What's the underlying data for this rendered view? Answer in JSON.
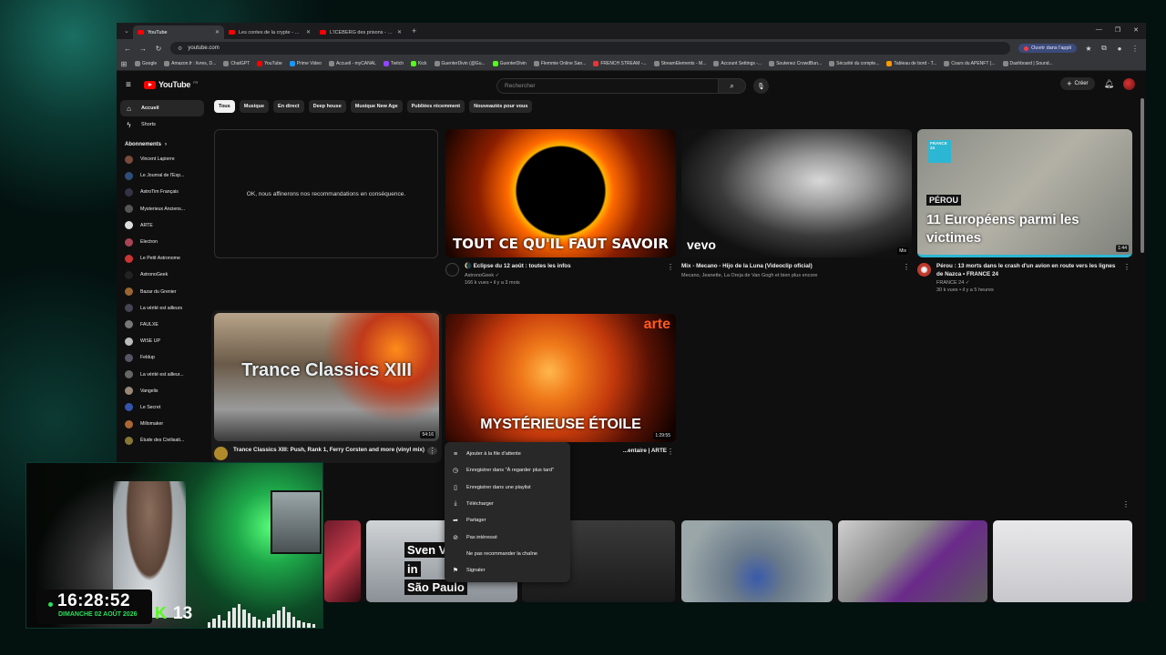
{
  "browser": {
    "tabs": [
      {
        "title": "YouTube",
        "active": true
      },
      {
        "title": "Les contes de la crypte - YouTube",
        "active": false
      },
      {
        "title": "L'ICEBERG des prisons - YouTube",
        "active": false
      }
    ],
    "url": "youtube.com",
    "open_app_label": "Ouvrir dans l'appli",
    "bookmarks": [
      "Google",
      "Amazon.fr : livres, D...",
      "ChatGPT",
      "YouTube",
      "Prime Video",
      "Accueil - myCANAL",
      "Twitch",
      "Kick",
      "GuenterDivin (@Gu...",
      "GuenterDivin",
      "Flemmie Online San...",
      "FRENCH STREAM -...",
      "StreamElements - M...",
      "Account Settings -...",
      "Soutenez CrowdBun...",
      "Sécurité du compte...",
      "Tableau de bord - T...",
      "Cours du APENFT (...",
      "Dashboard | Sound..."
    ]
  },
  "youtube": {
    "logo_text": "YouTube",
    "logo_region": "FR",
    "search_placeholder": "Rechercher",
    "create_label": "Créer",
    "sidebar": {
      "main": [
        {
          "label": "Accueil",
          "icon": "home-icon",
          "glyph": "⌂",
          "active": true
        },
        {
          "label": "Shorts",
          "icon": "shorts-icon",
          "glyph": "ϟ",
          "active": false
        }
      ],
      "subscriptions_heading": "Abonnements",
      "subscriptions": [
        {
          "label": "Vincent Lapierre",
          "color": "#7a4a3a"
        },
        {
          "label": "Le Journal de l'Esp...",
          "color": "#2e4e7a"
        },
        {
          "label": "AstroTim Français",
          "color": "#333344"
        },
        {
          "label": "Mysterieux Anciens...",
          "color": "#555555"
        },
        {
          "label": "ARTE",
          "color": "#dddddd"
        },
        {
          "label": "Electron",
          "color": "#aa4455"
        },
        {
          "label": "Le Petit Astronome",
          "color": "#cc3333"
        },
        {
          "label": "AstronoGeek",
          "color": "#222222"
        },
        {
          "label": "Bazar du Grenier",
          "color": "#996633"
        },
        {
          "label": "La vérité est ailleurs",
          "color": "#444455"
        },
        {
          "label": "FAULXE",
          "color": "#777777"
        },
        {
          "label": "WISE UP",
          "color": "#bbbbbb"
        },
        {
          "label": "Feldup",
          "color": "#555566"
        },
        {
          "label": "La vérité est ailleur...",
          "color": "#666666"
        },
        {
          "label": "Vangelis",
          "color": "#998877"
        },
        {
          "label": "Le Secret",
          "color": "#3355aa"
        },
        {
          "label": "Millomaker",
          "color": "#aa6633"
        },
        {
          "label": "Étude des Civilisati...",
          "color": "#887733"
        }
      ]
    },
    "chips": [
      {
        "label": "Tous",
        "active": true
      },
      {
        "label": "Musique",
        "active": false
      },
      {
        "label": "En direct",
        "active": false
      },
      {
        "label": "Deep house",
        "active": false
      },
      {
        "label": "Musique New Age",
        "active": false
      },
      {
        "label": "Publiées récemment",
        "active": false
      },
      {
        "label": "Nouveautés pour vous",
        "active": false
      }
    ],
    "feedback_text": "OK, nous affinerons nos recommandations en conséquence.",
    "videos": [
      {
        "title": "🌘 Eclipse du 12 août : toutes les infos",
        "channel": "AstronoGeek ✓",
        "stats": "166 k vues • il y a 3 mois",
        "thumb_text": "TOUT CE QU'IL FAUT SAVOIR",
        "duration": ""
      },
      {
        "title": "Mix - Mecano - Hijo de la Luna (Videoclip oficial)",
        "channel": "Mecano, Jeanette, La Oreja de Van Gogh et bien plus encore",
        "stats": "",
        "thumb_text": "vevo",
        "duration": "Mix"
      },
      {
        "title": "Pérou : 13 morts dans le crash d'un avion en route vers les lignes de Nazca • FRANCE 24",
        "channel": "FRANCE 24 ✓",
        "stats": "30 k vues • il y a 5 heures",
        "thumb_text": "11 Européens parmi les victimes",
        "thumb_tag": "PÉROU",
        "thumb_logo": "FRANCE 24",
        "duration": "1:44"
      },
      {
        "title": "Trance Classics XIII: Push, Rank 1, Ferry Corsten and more (vinyl mix)",
        "channel": "",
        "stats": "",
        "thumb_text": "Trance Classics XIII",
        "duration": "54:16"
      },
      {
        "title": "...entaire | ARTE",
        "channel": "",
        "stats": "",
        "thumb_text": "MYSTÉRIEUSE ÉTOILE",
        "thumb_logo": "arte",
        "duration": "1:29:55"
      }
    ],
    "context_menu": [
      {
        "label": "Ajouter à la file d'attente",
        "icon": "queue-icon",
        "glyph": "≡"
      },
      {
        "label": "Enregistrer dans \"À regarder plus tard\"",
        "icon": "clock-icon",
        "glyph": "◷"
      },
      {
        "label": "Enregistrer dans une playlist",
        "icon": "bookmark-icon",
        "glyph": "▯"
      },
      {
        "label": "Télécharger",
        "icon": "download-icon",
        "glyph": "⤓"
      },
      {
        "label": "Partager",
        "icon": "share-icon",
        "glyph": "➦"
      },
      {
        "label": "Pas intéressé",
        "icon": "block-icon",
        "glyph": "⊘"
      },
      {
        "label": "Ne pas recommander la chaîne",
        "icon": "minus-circle-icon",
        "glyph": ""
      },
      {
        "label": "Signaler",
        "icon": "flag-icon",
        "glyph": "⚑"
      }
    ],
    "shorts_text": [
      "Sven V",
      "in",
      "São Paulo"
    ]
  },
  "overlay": {
    "time": "16:28:52",
    "date": "DIMANCHE 02 AOÛT 2026",
    "kick_letter": "K",
    "viewer_count": "13"
  }
}
